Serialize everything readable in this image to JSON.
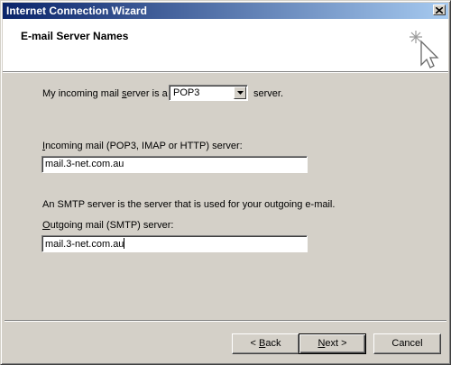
{
  "window": {
    "title": "Internet Connection Wizard"
  },
  "header": {
    "heading": "E-mail Server Names",
    "icon": "wizard-sparkle-cursor-icon"
  },
  "incoming_server_type": {
    "prefix": "My incoming mail ",
    "underlined": "s",
    "suffix": "erver is a",
    "selected": "POP3",
    "after": "server."
  },
  "incoming": {
    "label_underlined": "I",
    "label_rest": "ncoming mail (POP3, IMAP or HTTP) server:",
    "value": "mail.3-net.com.au"
  },
  "smtp_info": "An SMTP server is the server that is used for your outgoing e-mail.",
  "outgoing": {
    "label_underlined": "O",
    "label_rest": "utgoing mail (SMTP) server:",
    "value": "mail.3-net.com.au"
  },
  "buttons": {
    "back_prefix": "< ",
    "back_underlined": "B",
    "back_rest": "ack",
    "next_underlined": "N",
    "next_rest": "ext >",
    "cancel": "Cancel"
  }
}
